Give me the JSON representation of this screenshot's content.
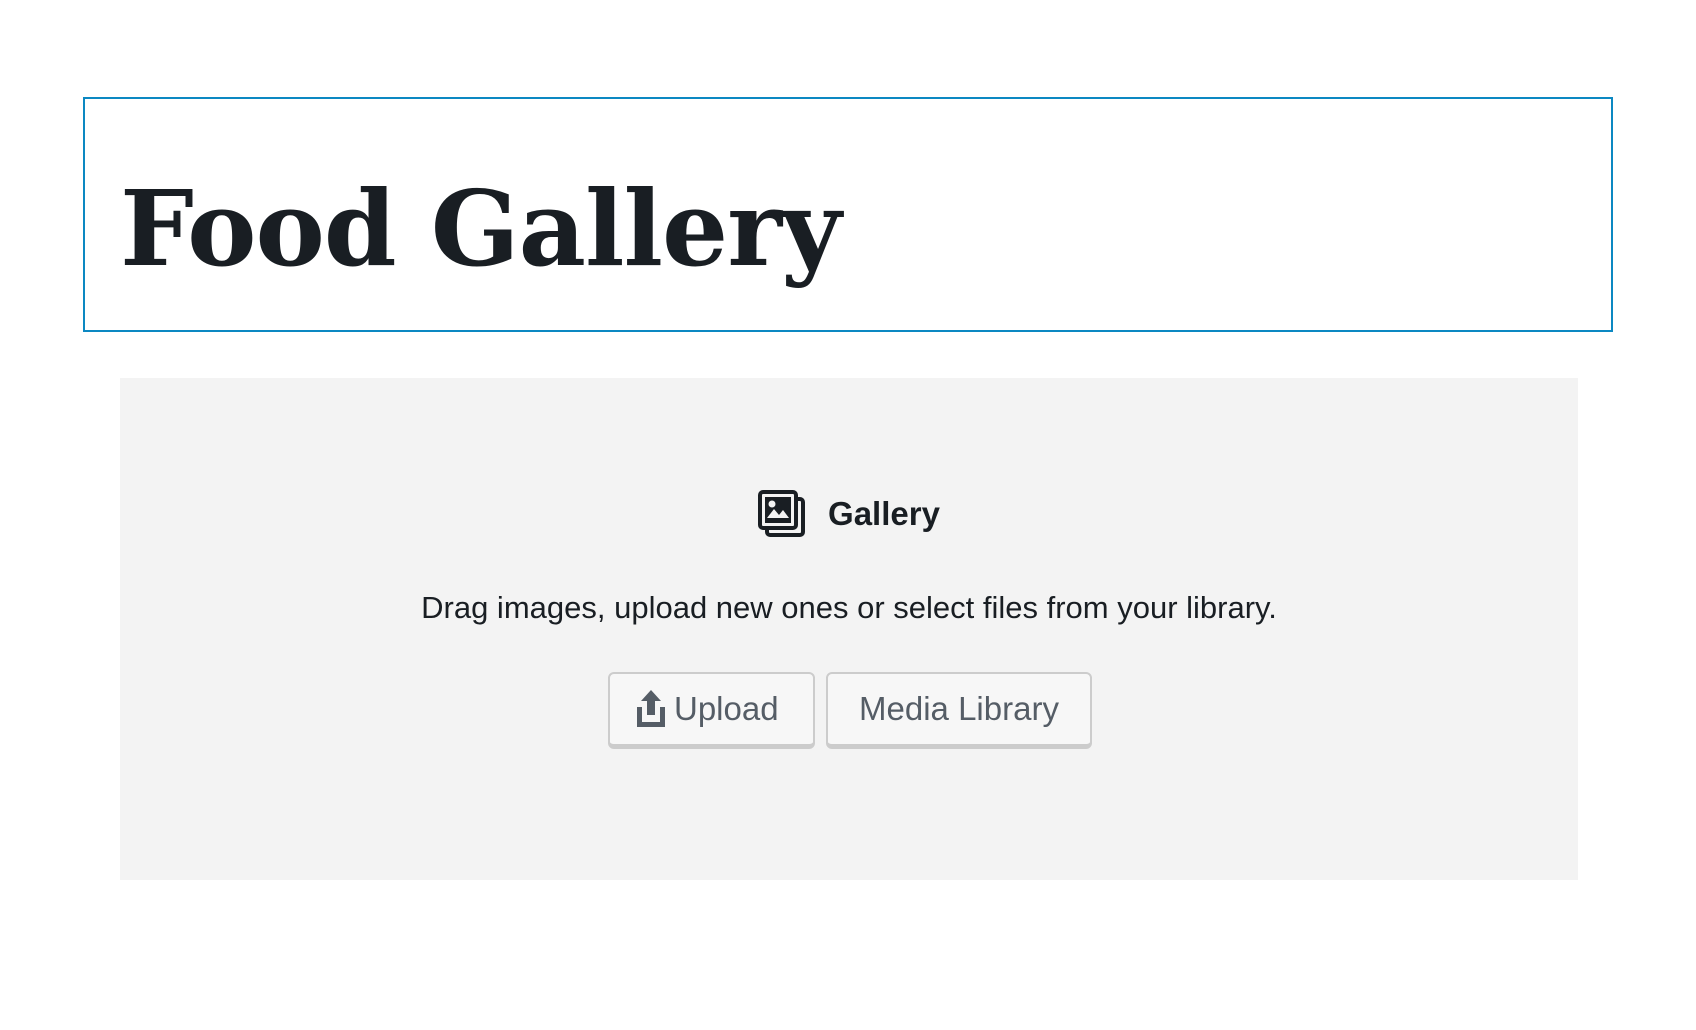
{
  "post_title": {
    "text": "Food Gallery"
  },
  "gallery_block": {
    "icon": "gallery-icon",
    "label": "Gallery",
    "instructions": "Drag images, upload new ones or select files from your library.",
    "buttons": {
      "upload": {
        "icon": "upload-icon",
        "label": "Upload"
      },
      "media_library": {
        "label": "Media Library"
      }
    }
  },
  "colors": {
    "title_block_border": "#0c88c2",
    "placeholder_background": "#f3f3f3",
    "text": "#191e23",
    "button_text": "#555d66",
    "button_border": "#cccccc"
  }
}
